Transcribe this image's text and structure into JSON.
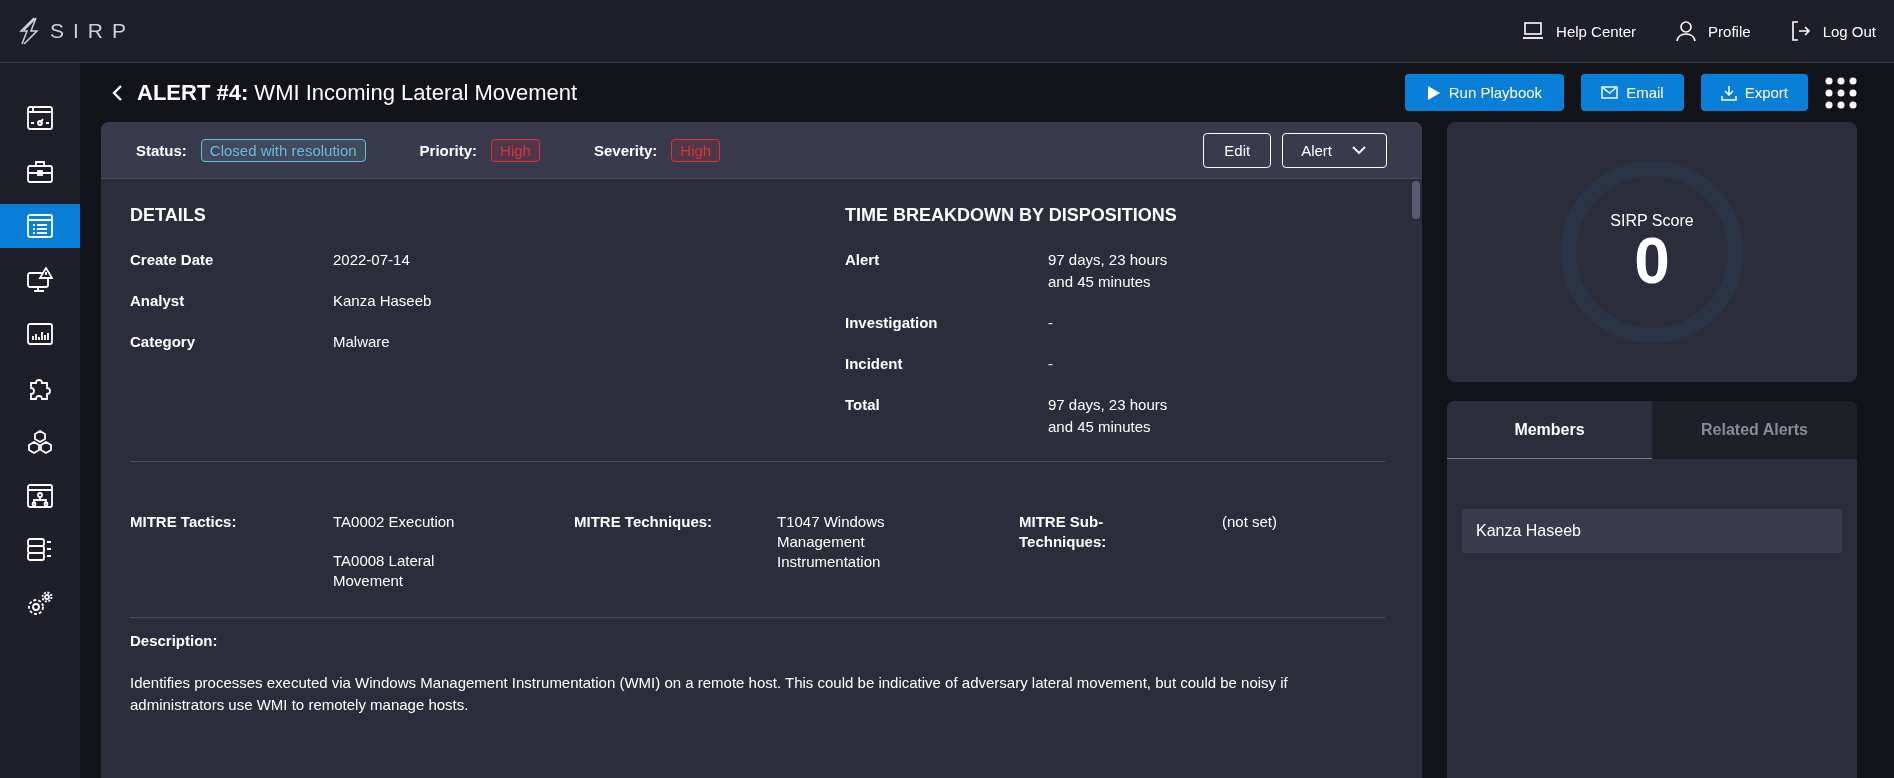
{
  "topbar": {
    "logo": "SIRP",
    "links": [
      {
        "kind": "help",
        "label": "Help Center"
      },
      {
        "kind": "profile",
        "label": "Profile"
      },
      {
        "kind": "logout",
        "label": "Log Out"
      }
    ]
  },
  "sidebar": {
    "items": [
      {
        "kind": "dashboard",
        "selected": false
      },
      {
        "kind": "cases",
        "selected": false
      },
      {
        "kind": "alerts",
        "selected": true
      },
      {
        "kind": "monitor",
        "selected": false
      },
      {
        "kind": "reports",
        "selected": false
      },
      {
        "kind": "integrations",
        "selected": false
      },
      {
        "kind": "assets",
        "selected": false
      },
      {
        "kind": "workflow",
        "selected": false
      },
      {
        "kind": "database",
        "selected": false
      },
      {
        "kind": "settings",
        "selected": false
      }
    ]
  },
  "header": {
    "title_prefix": "ALERT #4:",
    "title": "WMI Incoming Lateral Movement",
    "actions": [
      {
        "kind": "play",
        "label": "Run Playbook"
      },
      {
        "kind": "email",
        "label": "Email"
      },
      {
        "kind": "export",
        "label": "Export"
      }
    ]
  },
  "status_bar": {
    "fields": [
      {
        "label": "Status:",
        "value": "Closed with resolution",
        "color": "#6fb8d8"
      },
      {
        "label": "Priority:",
        "value": "High",
        "color": "#e0303c"
      },
      {
        "label": "Severity:",
        "value": "High",
        "color": "#e0303c"
      }
    ],
    "edit": "Edit",
    "dropdown": "Alert"
  },
  "details": {
    "heading": "DETAILS",
    "rows": [
      {
        "label": "Create Date",
        "value": "2022-07-14"
      },
      {
        "label": "Analyst",
        "value": "Kanza Haseeb"
      },
      {
        "label": "Category",
        "value": "Malware"
      }
    ]
  },
  "time_breakdown": {
    "heading": "TIME BREAKDOWN BY DISPOSITIONS",
    "rows": [
      {
        "label": "Alert",
        "value": "97 days, 23 hours and 45 minutes"
      },
      {
        "label": "Investigation",
        "value": "-"
      },
      {
        "label": "Incident",
        "value": "-"
      },
      {
        "label": "Total",
        "value": "97 days, 23 hours and 45 minutes"
      }
    ]
  },
  "mitre": [
    {
      "label": "MITRE Tactics:",
      "values": [
        "TA0002 Execution",
        "TA0008 Lateral Movement"
      ]
    },
    {
      "label": "MITRE Techniques:",
      "values": [
        "T1047 Windows Management Instrumentation"
      ]
    },
    {
      "label": "MITRE Sub-Techniques:",
      "values": [
        "(not set)"
      ]
    }
  ],
  "description": {
    "label": "Description:",
    "text": "Identifies processes executed via Windows Management Instrumentation (WMI) on a remote host. This could be indicative of adversary lateral movement, but could be noisy if administrators use WMI to remotely manage hosts."
  },
  "score": {
    "label": "SIRP Score",
    "value": "0"
  },
  "members_panel": {
    "tabs": [
      {
        "label": "Members",
        "selected": true
      },
      {
        "label": "Related Alerts",
        "selected": false
      }
    ],
    "members": [
      "Kanza Haseeb"
    ]
  }
}
